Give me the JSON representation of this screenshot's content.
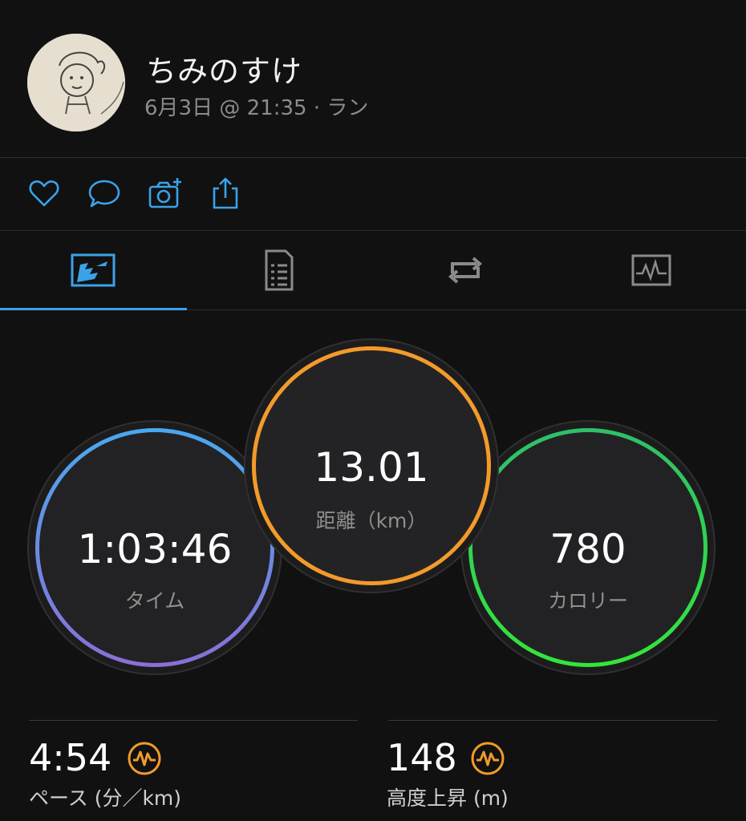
{
  "header": {
    "user_name": "ちみのすけ",
    "meta": "6月3日 @ 21:35 · ラン"
  },
  "actions": [
    "heart-icon",
    "comment-icon",
    "camera-add-icon",
    "share-icon"
  ],
  "tabs": [
    "overview-map-icon",
    "details-document-icon",
    "laps-loop-icon",
    "chart-graph-icon"
  ],
  "active_tab": 0,
  "colors": {
    "accent": "#3aa3e8",
    "time_ring": [
      "#4aa8ef",
      "#8a6fd6"
    ],
    "distance_ring": "#f39a2b",
    "calories_ring": [
      "#2fbf6a",
      "#33e63a"
    ],
    "badge": "#f39a2b"
  },
  "summary": {
    "time": {
      "value": "1:03:46",
      "label": "タイム"
    },
    "distance": {
      "value": "13.01",
      "label": "距離（km）"
    },
    "calories": {
      "value": "780",
      "label": "カロリー"
    }
  },
  "stats": {
    "pace": {
      "value": "4:54",
      "label": "ペース (分／km)"
    },
    "elevation": {
      "value": "148",
      "label": "高度上昇 (m)"
    }
  }
}
